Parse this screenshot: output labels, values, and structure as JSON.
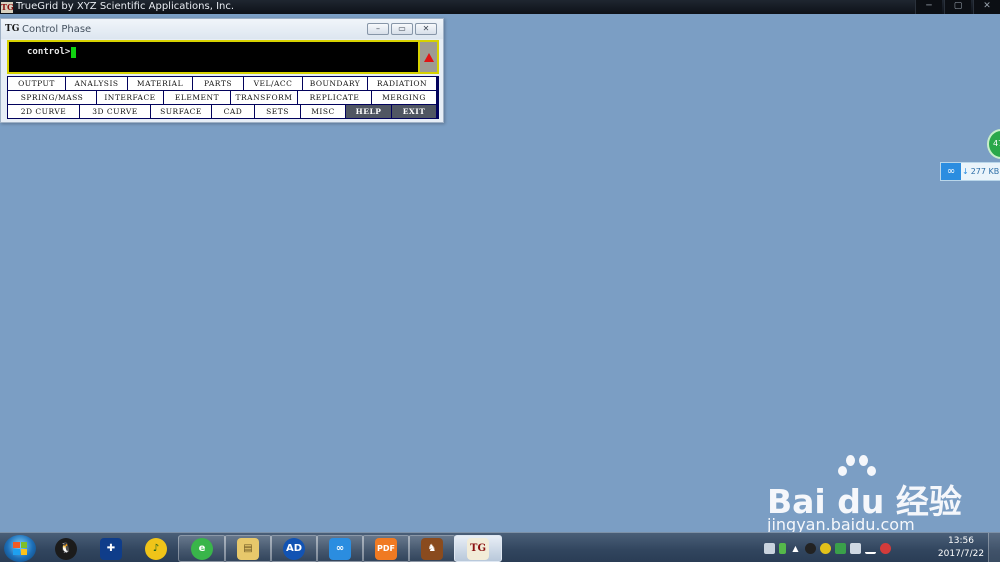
{
  "app": {
    "title": "TrueGrid by XYZ Scientific Applications, Inc.",
    "logo": "TG",
    "window_buttons": [
      "─",
      "▢",
      "✕"
    ]
  },
  "control_window": {
    "title": "Control Phase",
    "logo": "TG",
    "buttons": [
      "–",
      "▭",
      "✕"
    ],
    "prompt": "control>"
  },
  "menu": {
    "rows": [
      [
        "OUTPUT",
        "ANALYSIS",
        "MATERIAL",
        "PARTS",
        "VEL/ACC",
        "BOUNDARY",
        "RADIATION"
      ],
      [
        "SPRING/MASS",
        "INTERFACE",
        "ELEMENT",
        "TRANSFORM",
        "REPLICATE",
        "MERGING"
      ],
      [
        "2D CURVE",
        "3D CURVE",
        "SURFACE",
        "CAD",
        "SETS",
        "MISC",
        "HELP",
        "EXIT"
      ]
    ]
  },
  "floating": {
    "circle_text": "47",
    "net_speed": "277 KB"
  },
  "watermark": {
    "brand": "Bai du 经验",
    "url": "jingyan.baidu.com"
  },
  "taskbar": {
    "pinned_icons": [
      {
        "name": "qq-icon",
        "glyph": "🐧"
      },
      {
        "name": "network-tool-icon",
        "glyph": "✚"
      },
      {
        "name": "music-player-icon",
        "glyph": "♪"
      },
      {
        "name": "browser-icon",
        "glyph": "e"
      },
      {
        "name": "file-explorer-icon",
        "glyph": "▤"
      },
      {
        "name": "autodesk-icon",
        "glyph": "AD"
      },
      {
        "name": "baidu-cloud-icon",
        "glyph": "∞"
      },
      {
        "name": "pdf-reader-icon",
        "glyph": "PDF"
      },
      {
        "name": "game-icon",
        "glyph": "♞"
      },
      {
        "name": "truegrid-icon",
        "glyph": "TG"
      }
    ],
    "clock_time": "13:56",
    "clock_date": "2017/7/22"
  },
  "colors": {
    "desktop": "#7b9ec4",
    "menu_bg": "#02025c",
    "console_border": "#d7d200",
    "cursor": "#10d210"
  }
}
